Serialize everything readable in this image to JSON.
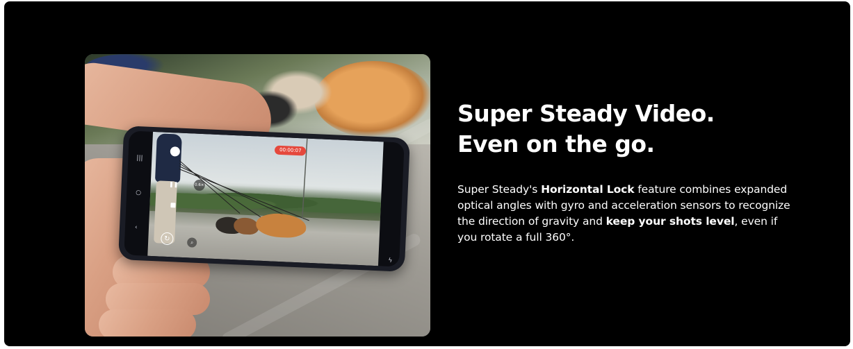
{
  "section": {
    "headline_line1": "Super Steady Video.",
    "headline_line2": "Even on the go.",
    "body": {
      "text1": "Super Steady's ",
      "bold1": "Horizontal Lock",
      "text2": " feature combines expanded optical angles with gyro and acceleration sensors to recognize the direction of gravity and ",
      "bold2": "keep your shots level",
      "text3": ", even if you rotate a full 360°."
    }
  },
  "camera_ui": {
    "record_timer": "00:00:07",
    "zoom_label": "0.6×"
  },
  "colors": {
    "background": "#000000",
    "text": "#ffffff",
    "record_red": "#e5483c"
  }
}
